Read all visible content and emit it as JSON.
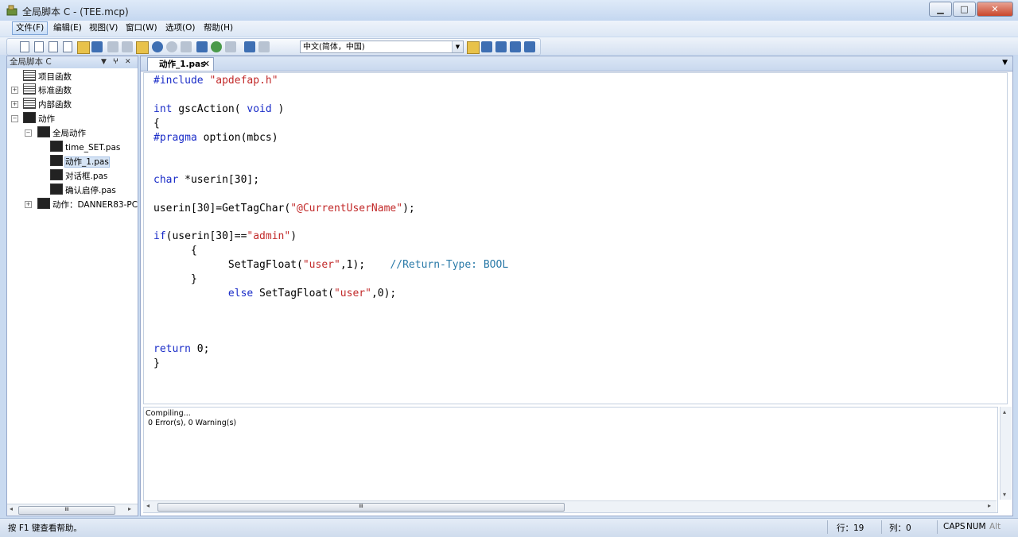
{
  "window": {
    "title": "全局脚本 C - (TEE.mcp)",
    "minimize_icon": "minimize-icon",
    "maximize_icon": "maximize-icon",
    "close_icon": "close-icon"
  },
  "menu": {
    "items": [
      "文件(F)",
      "编辑(E)",
      "视图(V)",
      "窗口(W)",
      "选项(O)",
      "帮助(H)"
    ]
  },
  "toolbar": {
    "language_select": "中文(简体，中国)"
  },
  "left_panel": {
    "title": "全局脚本 C",
    "pin_glyph": "▾  ᵖ  ✕",
    "tree": [
      {
        "label": "项目函数"
      },
      {
        "label": "标准函数"
      },
      {
        "label": "内部函数"
      },
      {
        "label": "动作"
      },
      {
        "label": "全局动作"
      },
      {
        "label": "time_SET.pas"
      },
      {
        "label": "动作_1.pas"
      },
      {
        "label": "对话框.pas"
      },
      {
        "label": "确认启停.pas"
      },
      {
        "label": "动作：DANNER83-PC"
      }
    ],
    "scroll_thumb": "III"
  },
  "editor": {
    "tab_label": "动作_1.pas",
    "tab_close": "✕",
    "tab_dropdown": "▼"
  },
  "code_lines": {
    "l1a": "#include ",
    "l1b": "\"apdefap.h\"",
    "l2a": "int",
    "l2b": " gscAction( ",
    "l2c": "void",
    "l2d": " )",
    "l3": "{",
    "l4a": "#pragma",
    "l4b": " option(mbcs)",
    "l5a": "char",
    "l5b": " *userin[30];",
    "l6a": "userin[30]=GetTagChar(",
    "l6b": "\"@CurrentUserName\"",
    "l6c": ");",
    "l7a": "if",
    "l7b": "(userin[30]==",
    "l7c": "\"admin\"",
    "l7d": ")",
    "l8": "      {",
    "l9a": "            SetTagFloat(",
    "l9b": "\"user\"",
    "l9c": ",1);    ",
    "l9d": "//Return-Type: BOOL",
    "l10": "      }",
    "l11a": "            ",
    "l11b": "else",
    "l11c": " SetTagFloat(",
    "l11d": "\"user\"",
    "l11e": ",0);",
    "l12a": "return",
    "l12b": " 0;",
    "l13": "}"
  },
  "output": {
    "line1": "Compiling...",
    "line2": "0 Error(s), 0 Warning(s)",
    "scroll_thumb": "III"
  },
  "status": {
    "help": "按 F1 键查看帮助。",
    "row": "行：19",
    "col": "列：0",
    "caps": "CAPS",
    "num": "NUM",
    "alt": "Alt"
  }
}
